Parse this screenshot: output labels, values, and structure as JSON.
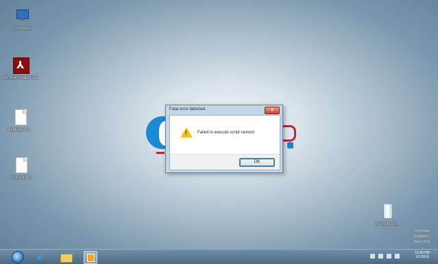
{
  "desktop": {
    "icons": [
      {
        "label": "Computer",
        "icon": "computer-icon"
      },
      {
        "label": "Acrobat Reader DC",
        "icon": "acrobat-reader-icon"
      },
      {
        "label": "dejdiegpas...",
        "icon": "document-file-icon"
      },
      {
        "label": "instructions",
        "icon": "document-file-icon"
      },
      {
        "label": "Recycle Bin",
        "icon": "recycle-bin-icon"
      }
    ]
  },
  "dialog": {
    "title": "Fatal error detected",
    "close_label": "x",
    "message": "Failed to execute script ransom",
    "ok_label": "OK",
    "icon": "warning-icon"
  },
  "watermark": {
    "line1": "Test Mode",
    "line2": "Windows 7",
    "line3": "Build 7601"
  },
  "taskbar": {
    "buttons": [
      "start-orb",
      "internet-explorer-icon",
      "file-explorer-icon",
      "media-player-icon"
    ],
    "clock_time": "12:43 PM",
    "clock_date": "1/1/2016"
  },
  "colors": {
    "desktop_center": "#f4f7f9",
    "desktop_edge": "#5f7f97",
    "taskbar": "#4a6a83",
    "dialog_frame": "#c3d6e8",
    "close_button": "#c8412b",
    "warning": "#f2c21b"
  }
}
